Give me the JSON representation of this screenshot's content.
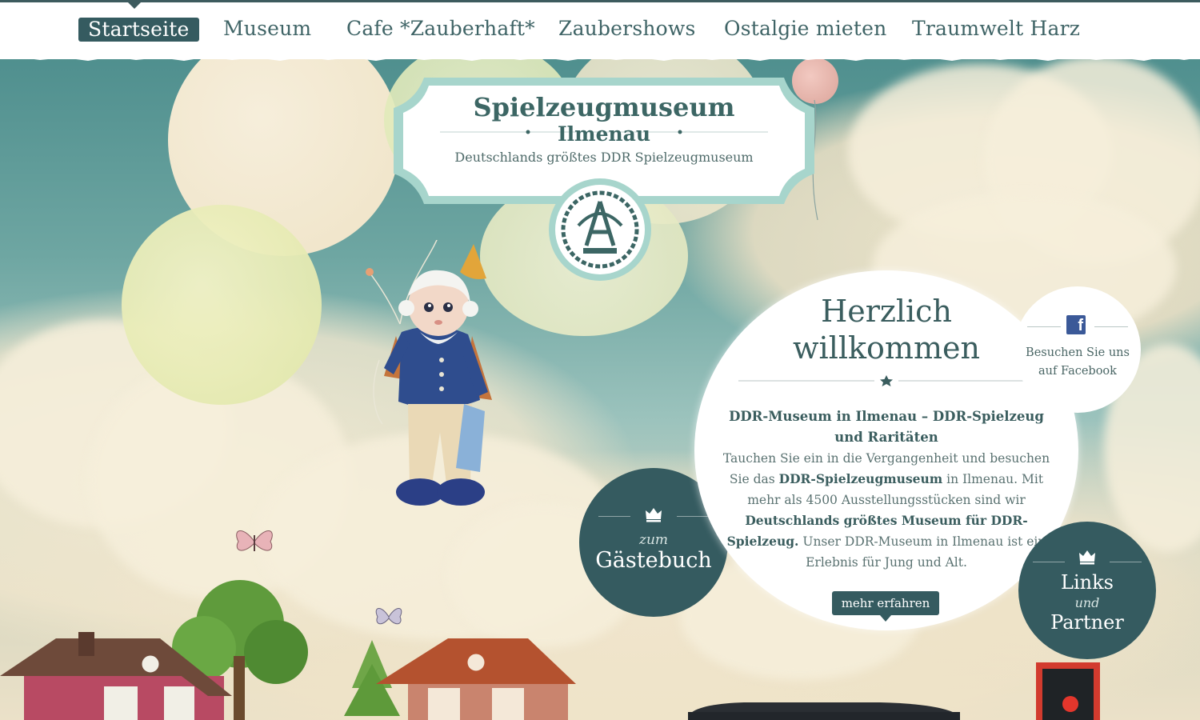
{
  "nav": {
    "items": [
      {
        "label": "Startseite",
        "active": true
      },
      {
        "label": "Museum",
        "active": false
      },
      {
        "label": "Cafe *Zauberhaft*",
        "active": false
      },
      {
        "label": "Zaubershows",
        "active": false
      },
      {
        "label": "Ostalgie mieten",
        "active": false
      },
      {
        "label": "Traumwelt Harz",
        "active": false
      }
    ]
  },
  "logo": {
    "title": "Spielzeugmuseum",
    "subtitle": "Ilmenau",
    "tagline": "Deutschlands größtes DDR Spielzeugmuseum",
    "emblem_icon": "ddr-emblem-icon"
  },
  "welcome": {
    "title_line1": "Herzlich",
    "title_line2": "willkommen",
    "heading": "DDR-Museum in Ilmenau – DDR-Spielzeug und Raritäten",
    "body_1": "Tauchen Sie ein in die Vergangenheit und besuchen Sie das ",
    "body_bold_1": "DDR-Spielzeugmuseum",
    "body_2": " in Ilmenau. Mit mehr als 4500 Ausstellungsstücken sind wir ",
    "body_bold_2": "Deutschlands größtes Museum für DDR-Spielzeug.",
    "body_3": " Unser DDR-Museum in Ilmenau ist ein Erlebnis für Jung und Alt.",
    "more_label": "mehr erfahren"
  },
  "facebook": {
    "icon": "facebook-icon",
    "line1": "Besuchen Sie uns",
    "line2": "auf Facebook"
  },
  "guestbook": {
    "icon": "crown-icon",
    "small": "zum",
    "big": "Gästebuch"
  },
  "links": {
    "icon": "crown-icon",
    "line1": "Links",
    "small": "und",
    "line2": "Partner"
  },
  "colors": {
    "accent": "#355b60",
    "text": "#3a5d5e",
    "facebook": "#3b5998"
  }
}
